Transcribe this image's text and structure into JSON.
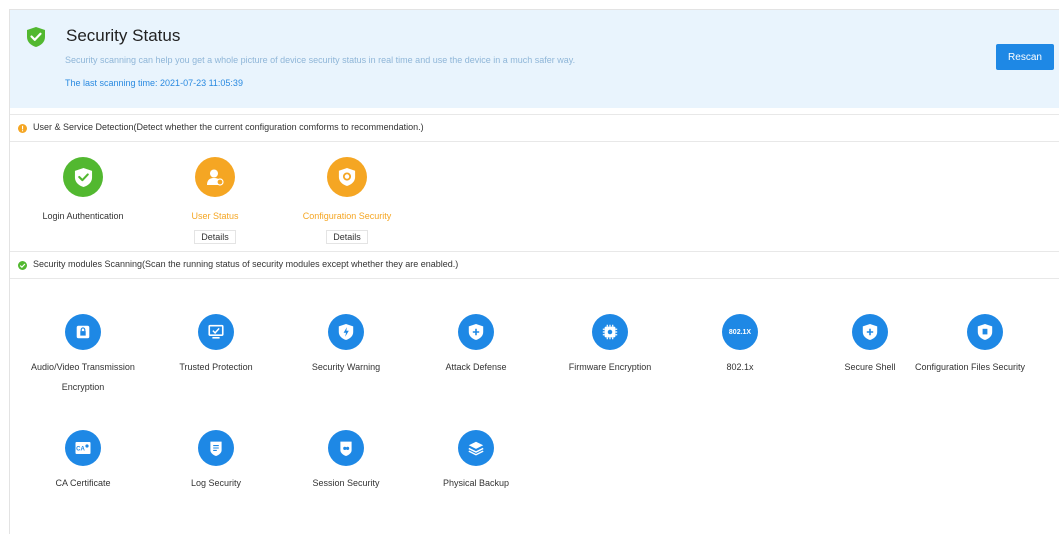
{
  "header": {
    "title": "Security Status",
    "description": "Security scanning can help you get a whole picture of device security status in real time and use the device in a much safer way.",
    "last_scan": "The last scanning time: 2021-07-23 11:05:39",
    "rescan_label": "Rescan"
  },
  "colors": {
    "accent": "#1e88e5",
    "ok": "#52b830",
    "warn": "#f5a623",
    "header_bg": "#e9f4fd"
  },
  "user_service": {
    "heading": "User & Service Detection(Detect whether the current configuration comforms to recommendation.)",
    "items": [
      {
        "label": "Login Authentication",
        "status": "ok",
        "icon": "shield-check-icon"
      },
      {
        "label": "User Status",
        "status": "warn",
        "icon": "user-icon",
        "details": "Details"
      },
      {
        "label": "Configuration Security",
        "status": "warn",
        "icon": "shield-gear-icon",
        "details": "Details"
      }
    ]
  },
  "modules": {
    "heading": "Security modules Scanning(Scan the running status of security modules except whether they are enabled.)",
    "items": [
      {
        "label_1": "Audio/Video Transmission",
        "label_2": "Encryption",
        "icon": "lock-doc-icon"
      },
      {
        "label": "Trusted Protection",
        "icon": "monitor-check-icon"
      },
      {
        "label": "Security Warning",
        "icon": "shield-bolt-icon"
      },
      {
        "label": "Attack Defense",
        "icon": "shield-plus-icon"
      },
      {
        "label": "Firmware Encryption",
        "icon": "chip-gear-icon"
      },
      {
        "label": "802.1x",
        "icon": "802-1x-icon",
        "icon_text": "802.1X"
      },
      {
        "label": "Secure Shell",
        "icon": "shield-plus-icon"
      },
      {
        "label": "Configuration Files Security",
        "icon": "shield-doc-icon"
      },
      {
        "label": "CA Certificate",
        "icon": "certificate-icon",
        "icon_text": "CA"
      },
      {
        "label": "Log Security",
        "icon": "log-shield-icon"
      },
      {
        "label": "Session Security",
        "icon": "session-shield-icon"
      },
      {
        "label": "Physical Backup",
        "icon": "layers-icon"
      }
    ]
  }
}
